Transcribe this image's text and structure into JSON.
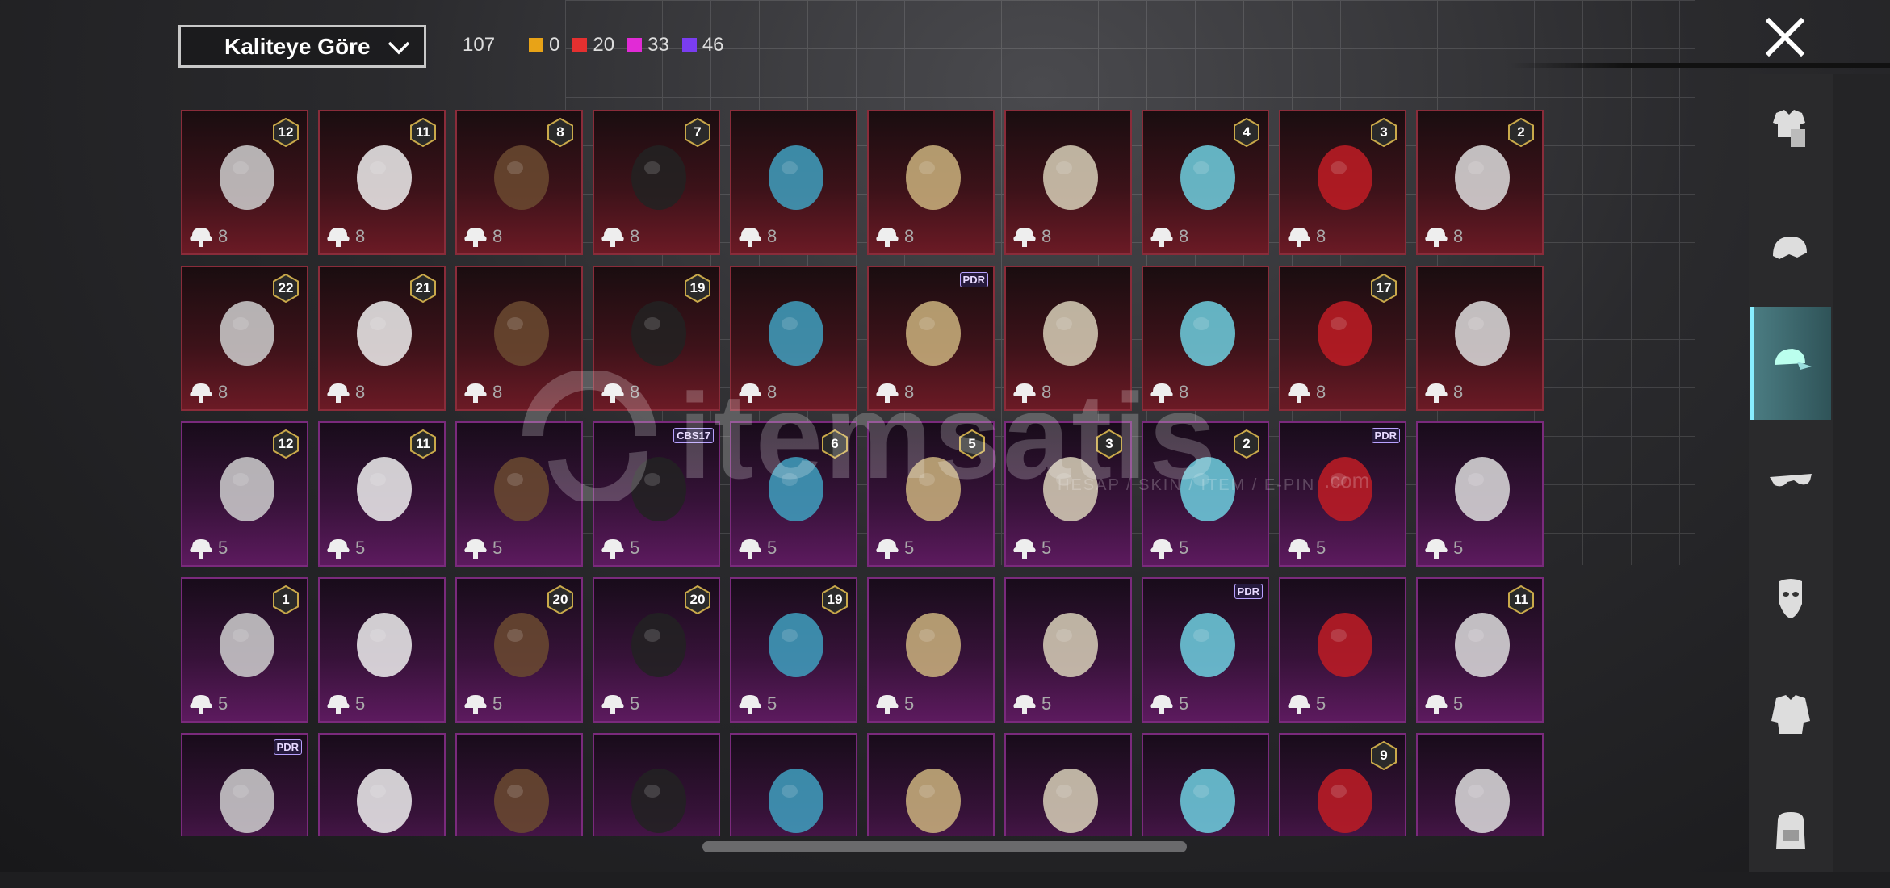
{
  "toolbar": {
    "sort_label": "Kaliteye Göre",
    "total_count": "107",
    "stats": [
      {
        "name": "gold",
        "color": "#e8a317",
        "value": "0"
      },
      {
        "name": "red",
        "color": "#e53030",
        "value": "20"
      },
      {
        "name": "pink",
        "color": "#e12bd6",
        "value": "33"
      },
      {
        "name": "purple",
        "color": "#7a3df0",
        "value": "46"
      }
    ]
  },
  "watermark": {
    "brand": "itemsatis",
    "tagline": "HESAP / SKIN / ITEM / E-PIN",
    "domain": ".com"
  },
  "side_tabs": [
    "outfit-icon",
    "helmet-icon",
    "cap-icon",
    "glasses-icon",
    "mask-icon",
    "jacket-icon",
    "backpack-icon"
  ],
  "items": [
    {
      "tier": "red",
      "badge": "12",
      "price": "8"
    },
    {
      "tier": "red",
      "badge": "11",
      "price": "8"
    },
    {
      "tier": "red",
      "badge": "8",
      "price": "8"
    },
    {
      "tier": "red",
      "badge": "7",
      "price": "8"
    },
    {
      "tier": "red",
      "badge": "",
      "price": "8"
    },
    {
      "tier": "red",
      "badge": "",
      "price": "8"
    },
    {
      "tier": "red",
      "badge": "",
      "price": "8"
    },
    {
      "tier": "red",
      "badge": "4",
      "price": "8"
    },
    {
      "tier": "red",
      "badge": "3",
      "price": "8"
    },
    {
      "tier": "red",
      "badge": "2",
      "price": "8"
    },
    {
      "tier": "red",
      "badge": "22",
      "price": "8"
    },
    {
      "tier": "red",
      "badge": "21",
      "price": "8"
    },
    {
      "tier": "red",
      "badge": "",
      "price": "8"
    },
    {
      "tier": "red",
      "badge": "19",
      "price": "8"
    },
    {
      "tier": "red",
      "badge": "",
      "price": "8"
    },
    {
      "tier": "red",
      "badge_text": "PDR",
      "price": "8"
    },
    {
      "tier": "red",
      "badge": "",
      "price": "8"
    },
    {
      "tier": "red",
      "badge": "",
      "price": "8"
    },
    {
      "tier": "red",
      "badge": "17",
      "price": "8"
    },
    {
      "tier": "red",
      "badge": "",
      "price": "8"
    },
    {
      "tier": "purple",
      "badge": "12",
      "price": "5"
    },
    {
      "tier": "purple",
      "badge": "11",
      "price": "5"
    },
    {
      "tier": "purple",
      "badge": "",
      "price": "5"
    },
    {
      "tier": "purple",
      "badge_text": "CBS17",
      "price": "5"
    },
    {
      "tier": "purple",
      "badge": "6",
      "price": "5"
    },
    {
      "tier": "purple",
      "badge": "5",
      "price": "5"
    },
    {
      "tier": "purple",
      "badge": "3",
      "price": "5"
    },
    {
      "tier": "purple",
      "badge": "2",
      "price": "5"
    },
    {
      "tier": "purple",
      "badge_text": "PDR",
      "price": "5"
    },
    {
      "tier": "purple",
      "badge": "",
      "price": "5"
    },
    {
      "tier": "purple",
      "badge": "1",
      "price": "5"
    },
    {
      "tier": "purple",
      "badge": "",
      "price": "5"
    },
    {
      "tier": "purple",
      "badge": "20",
      "price": "5"
    },
    {
      "tier": "purple",
      "badge": "20",
      "price": "5"
    },
    {
      "tier": "purple",
      "badge": "19",
      "price": "5"
    },
    {
      "tier": "purple",
      "badge": "",
      "price": "5"
    },
    {
      "tier": "purple",
      "badge": "",
      "price": "5"
    },
    {
      "tier": "purple",
      "badge_text": "PDR",
      "price": "5"
    },
    {
      "tier": "purple",
      "badge": "",
      "price": "5"
    },
    {
      "tier": "purple",
      "badge": "11",
      "price": "5"
    },
    {
      "tier": "purple",
      "badge_text": "PDR",
      "price": ""
    },
    {
      "tier": "purple",
      "badge": "",
      "price": ""
    },
    {
      "tier": "purple",
      "badge": "",
      "price": ""
    },
    {
      "tier": "purple",
      "badge": "",
      "price": ""
    },
    {
      "tier": "purple",
      "badge": "",
      "price": ""
    },
    {
      "tier": "purple",
      "badge": "",
      "price": ""
    },
    {
      "tier": "purple",
      "badge": "",
      "price": ""
    },
    {
      "tier": "purple",
      "badge": "",
      "price": ""
    },
    {
      "tier": "purple",
      "badge": "9",
      "price": ""
    },
    {
      "tier": "purple",
      "badge": "",
      "price": ""
    }
  ]
}
